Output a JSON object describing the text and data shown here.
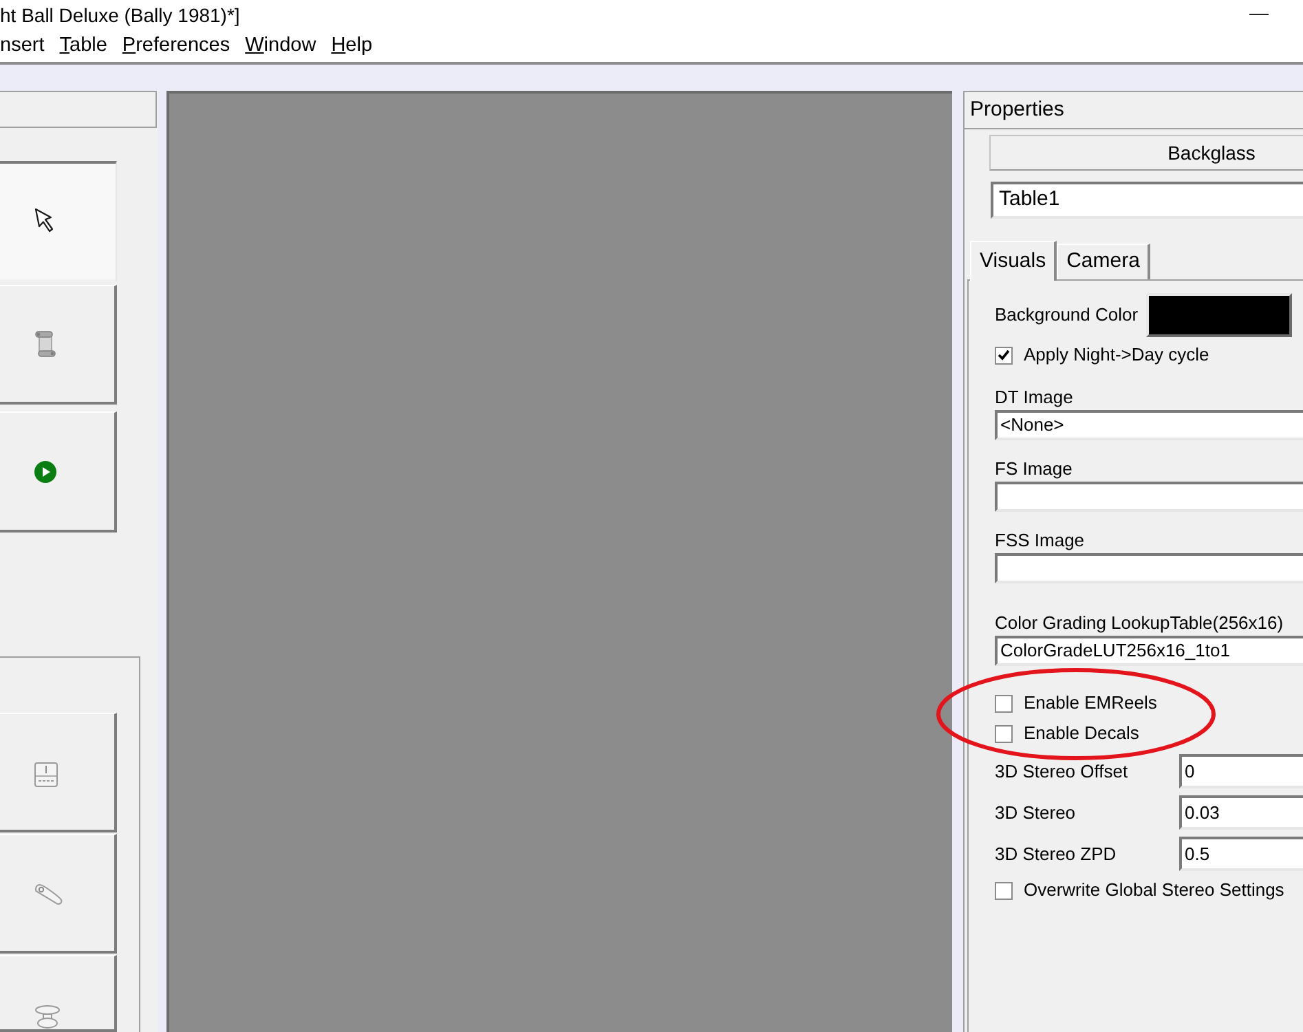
{
  "window": {
    "title": "ht Ball Deluxe (Bally 1981)*]"
  },
  "menu": [
    {
      "label": "nsert",
      "underlined": false
    },
    {
      "label": "Table",
      "underlined": true
    },
    {
      "label": "Preferences",
      "underlined": true
    },
    {
      "label": "Window",
      "underlined": true
    },
    {
      "label": "Help",
      "underlined": true
    }
  ],
  "toolbox": {
    "tools": [
      {
        "selected": true
      },
      {
        "selected": false
      },
      {
        "selected": false
      }
    ],
    "palette": [
      {
        "selected": false
      },
      {
        "selected": false
      },
      {
        "selected": false
      }
    ]
  },
  "properties": {
    "title": "Properties",
    "object_type": "Backglass",
    "name_field": {
      "value": "Table1"
    },
    "tabs": [
      {
        "label": "Visuals",
        "selected": true
      },
      {
        "label": "Camera",
        "selected": false
      }
    ],
    "fields": [
      {
        "kind": "color",
        "label": "Background Color",
        "color": "#000000"
      },
      {
        "kind": "checkbox",
        "label": "Apply Night->Day cycle",
        "checked": true
      },
      {
        "kind": "stacked",
        "label": "DT Image",
        "value": "<None>"
      },
      {
        "kind": "stacked",
        "label": "FS Image"
      },
      {
        "kind": "stacked",
        "label": "FSS Image"
      },
      {
        "kind": "stacked",
        "label": "Color Grading LookupTable(256x16)",
        "value": "ColorGradeLUT256x16_1to1"
      },
      {
        "kind": "checkbox",
        "label": "Enable EMReels",
        "checked": false
      },
      {
        "kind": "checkbox",
        "label": "Enable Decals",
        "checked": false
      },
      {
        "kind": "inline",
        "label": "3D Stereo Offset",
        "value": "0"
      },
      {
        "kind": "inline",
        "label": "3D Stereo",
        "value": "0.03"
      },
      {
        "kind": "inline",
        "label": "3D Stereo ZPD",
        "value": "0.5"
      },
      {
        "kind": "checkbox",
        "label": "Overwrite Global Stereo Settings",
        "checked": false
      }
    ]
  }
}
